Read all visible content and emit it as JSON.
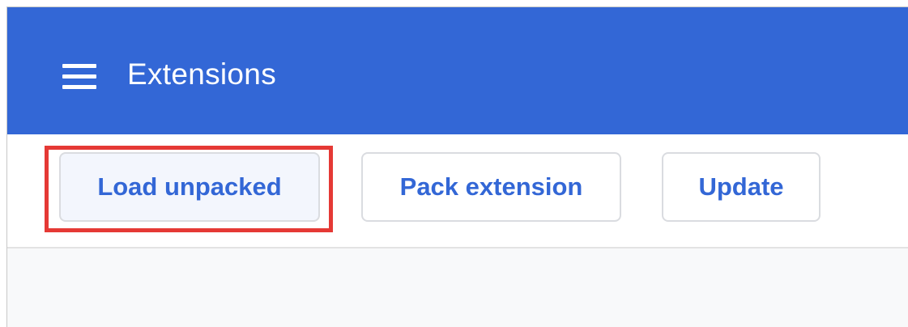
{
  "header": {
    "menu_icon": "hamburger-menu-icon",
    "title": "Extensions",
    "background_color": "#3367d6"
  },
  "toolbar": {
    "load_unpacked_label": "Load unpacked",
    "pack_extension_label": "Pack extension",
    "update_label": "Update"
  },
  "annotation": {
    "highlight_color": "#e53935",
    "highlighted": "Load unpacked"
  }
}
